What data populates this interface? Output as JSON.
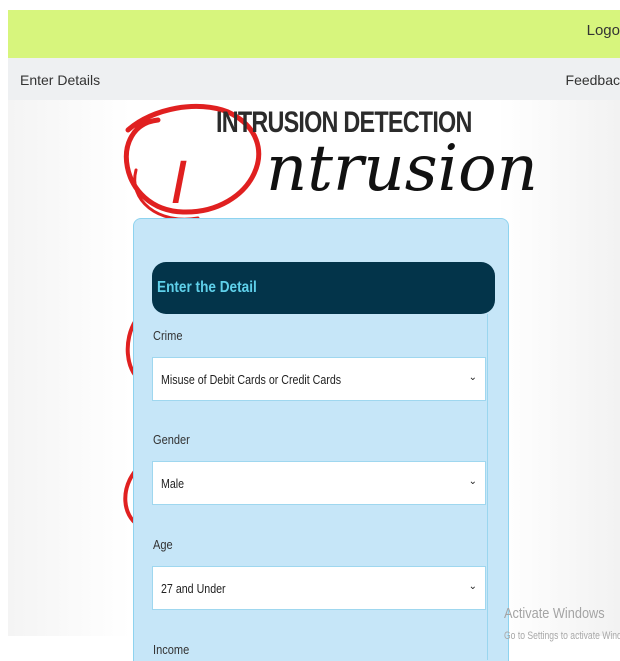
{
  "topbar": {
    "logout_label": "Logo"
  },
  "navbar": {
    "left_label": "Enter Details",
    "right_label": "Feedbac"
  },
  "hero": {
    "title": "INTRUSION DETECTION",
    "image_text": "ntrusion",
    "image_letter": "I"
  },
  "form": {
    "header": "Enter the Detail",
    "fields": [
      {
        "label": "Crime",
        "value": "Misuse of Debit Cards or Credit Cards"
      },
      {
        "label": "Gender",
        "value": "Male"
      },
      {
        "label": "Age",
        "value": "27 and Under"
      },
      {
        "label": "Income",
        "value": ""
      }
    ]
  },
  "watermark": {
    "title": "Activate Windows",
    "subtitle": "Go to Settings to activate Windows."
  },
  "colors": {
    "topbar": "#d7f57d",
    "form_header": "#03344a",
    "form_bg": "#c6e6f8",
    "accent_red": "#e02020"
  }
}
